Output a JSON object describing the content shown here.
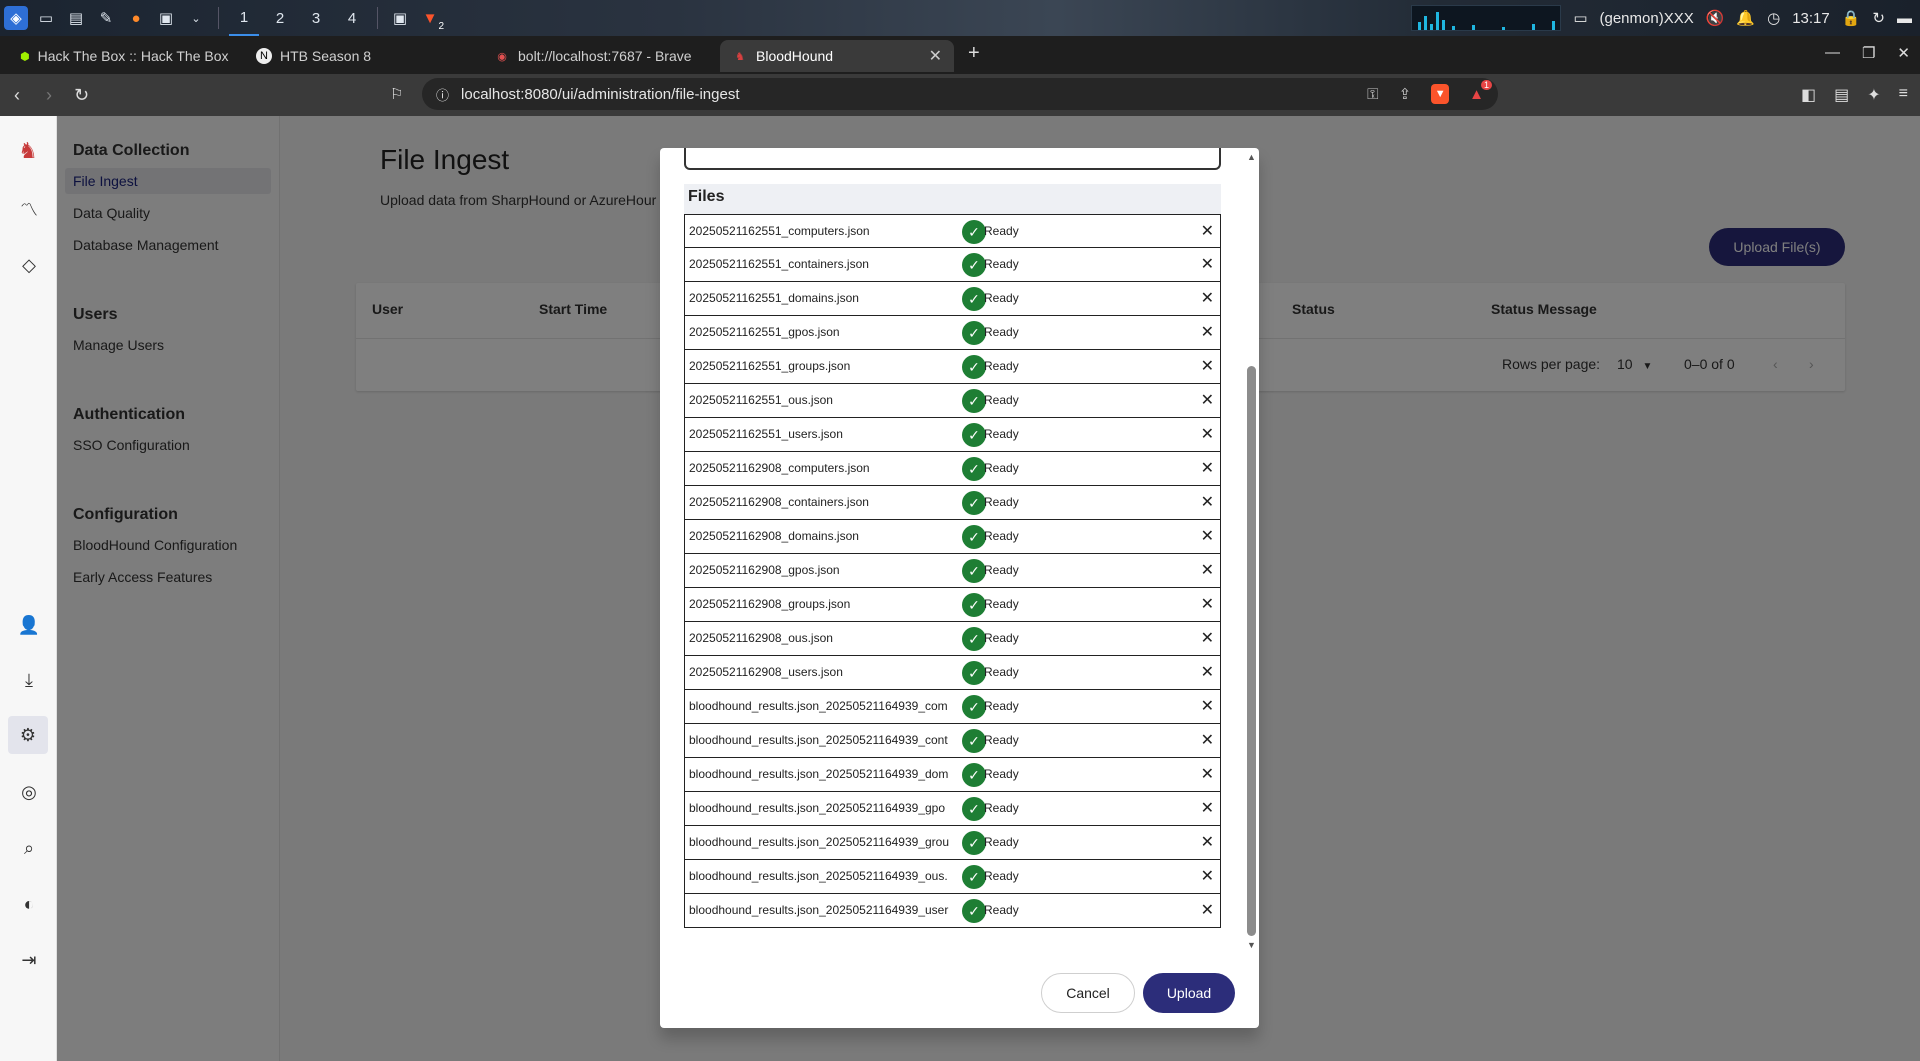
{
  "taskbar": {
    "workspaces": [
      "1",
      "2",
      "3",
      "4"
    ],
    "user": "(genmon)XXX",
    "clock": "13:17",
    "brave_badge": "2"
  },
  "browser": {
    "tabs": [
      {
        "title": "Hack The Box :: Hack The Box",
        "icon": "htb-icon"
      },
      {
        "title": "HTB Season 8",
        "icon": "notion-icon"
      },
      {
        "title": "bolt://localhost:7687 - Brave",
        "icon": "neo4j-icon"
      },
      {
        "title": "BloodHound",
        "icon": "bloodhound-icon"
      }
    ],
    "url": "localhost:8080/ui/administration/file-ingest",
    "shield_badge": "1"
  },
  "sidenav": {
    "sections": [
      {
        "heading": "Data Collection",
        "items": [
          "File Ingest",
          "Data Quality",
          "Database Management"
        ]
      },
      {
        "heading": "Users",
        "items": [
          "Manage Users"
        ]
      },
      {
        "heading": "Authentication",
        "items": [
          "SSO Configuration"
        ]
      },
      {
        "heading": "Configuration",
        "items": [
          "BloodHound Configuration",
          "Early Access Features"
        ]
      }
    ]
  },
  "page": {
    "title": "File Ingest",
    "subtitle": "Upload data from SharpHound or AzureHour",
    "upload_button": "Upload File(s)",
    "columns": [
      "User",
      "Start Time",
      "Status",
      "Status Message"
    ],
    "rows_per_page_label": "Rows per page:",
    "rows_per_page": "10",
    "range": "0–0 of 0"
  },
  "dialog": {
    "files_label": "Files",
    "files": [
      {
        "name": "20250521162551_computers.json",
        "status": "Ready"
      },
      {
        "name": "20250521162551_containers.json",
        "status": "Ready"
      },
      {
        "name": "20250521162551_domains.json",
        "status": "Ready"
      },
      {
        "name": "20250521162551_gpos.json",
        "status": "Ready"
      },
      {
        "name": "20250521162551_groups.json",
        "status": "Ready"
      },
      {
        "name": "20250521162551_ous.json",
        "status": "Ready"
      },
      {
        "name": "20250521162551_users.json",
        "status": "Ready"
      },
      {
        "name": "20250521162908_computers.json",
        "status": "Ready"
      },
      {
        "name": "20250521162908_containers.json",
        "status": "Ready"
      },
      {
        "name": "20250521162908_domains.json",
        "status": "Ready"
      },
      {
        "name": "20250521162908_gpos.json",
        "status": "Ready"
      },
      {
        "name": "20250521162908_groups.json",
        "status": "Ready"
      },
      {
        "name": "20250521162908_ous.json",
        "status": "Ready"
      },
      {
        "name": "20250521162908_users.json",
        "status": "Ready"
      },
      {
        "name": "bloodhound_results.json_20250521164939_com",
        "status": "Ready"
      },
      {
        "name": "bloodhound_results.json_20250521164939_cont",
        "status": "Ready"
      },
      {
        "name": "bloodhound_results.json_20250521164939_dom",
        "status": "Ready"
      },
      {
        "name": "bloodhound_results.json_20250521164939_gpo",
        "status": "Ready"
      },
      {
        "name": "bloodhound_results.json_20250521164939_grou",
        "status": "Ready"
      },
      {
        "name": "bloodhound_results.json_20250521164939_ous.",
        "status": "Ready"
      },
      {
        "name": "bloodhound_results.json_20250521164939_user",
        "status": "Ready"
      }
    ],
    "cancel": "Cancel",
    "upload": "Upload"
  },
  "colors": {
    "primary": "#2c2d7a",
    "ready": "#1e7e34"
  }
}
